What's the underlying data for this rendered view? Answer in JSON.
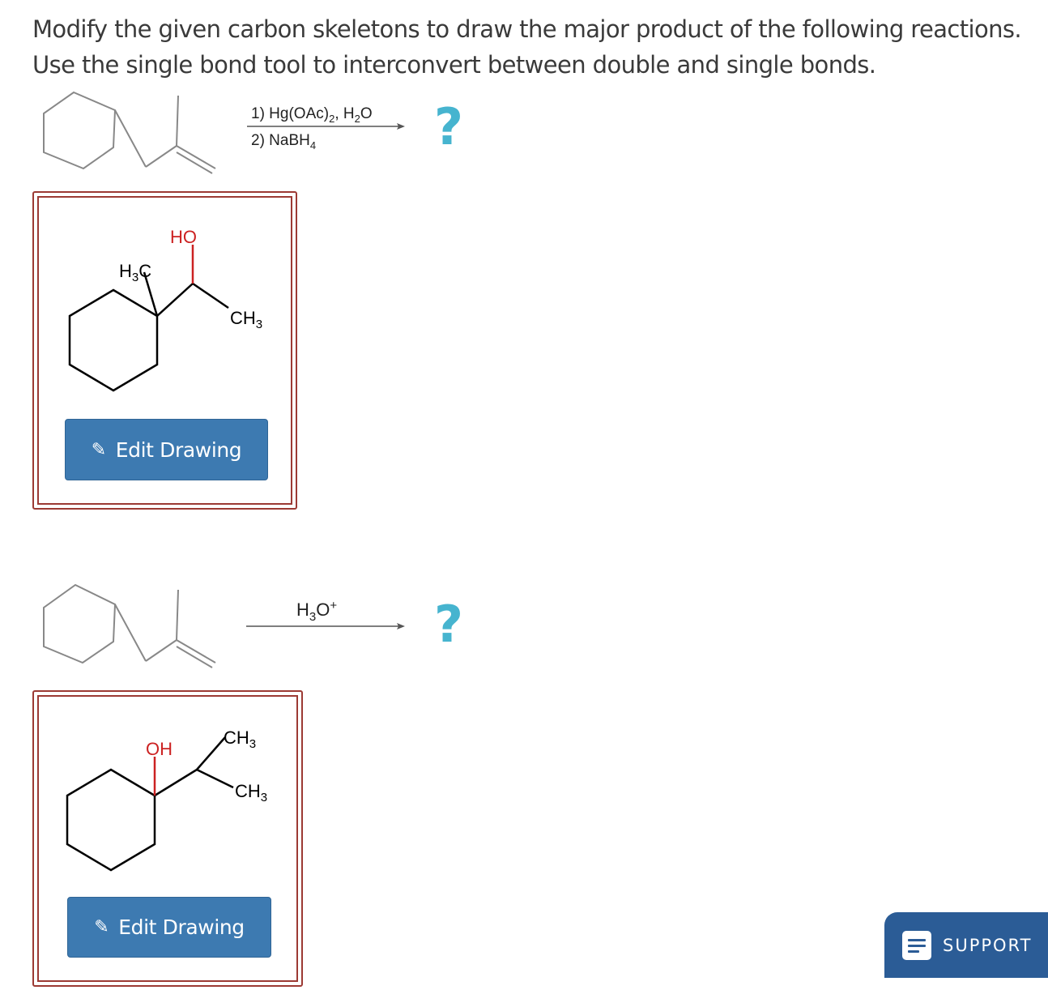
{
  "instructions": {
    "line1": "Modify the given carbon skeletons to draw the major product of the following reactions.",
    "line2": "Use the single bond tool to interconvert between double and single bonds."
  },
  "reaction1": {
    "reagent1_prefix": "1) Hg(OAc)",
    "reagent1_sub": "2",
    "reagent1_mid": ", H",
    "reagent1_sub2": "2",
    "reagent1_suffix": "O",
    "reagent2_prefix": "2) NaBH",
    "reagent2_sub": "4",
    "product": "?"
  },
  "answer1": {
    "label_ho": "HO",
    "label_h3c_h": "H",
    "label_h3c_sub": "3",
    "label_h3c_c": "C",
    "label_ch3": "CH",
    "label_ch3_sub": "3",
    "edit_button": "Edit Drawing"
  },
  "reaction2": {
    "reagent_prefix": "H",
    "reagent_sub": "3",
    "reagent_o": "O",
    "reagent_sup": "+",
    "product": "?"
  },
  "answer2": {
    "label_oh": "OH",
    "label_ch3_top": "CH",
    "label_ch3_top_sub": "3",
    "label_ch3_bottom": "CH",
    "label_ch3_bottom_sub": "3",
    "edit_button": "Edit Drawing"
  },
  "support": {
    "label": "SUPPORT"
  },
  "colors": {
    "question_mark": "#46b4cf",
    "answer_border": "#9c3a34",
    "button": "#3d7ab1",
    "support": "#2b5c96",
    "oxygen": "#cc2222"
  }
}
